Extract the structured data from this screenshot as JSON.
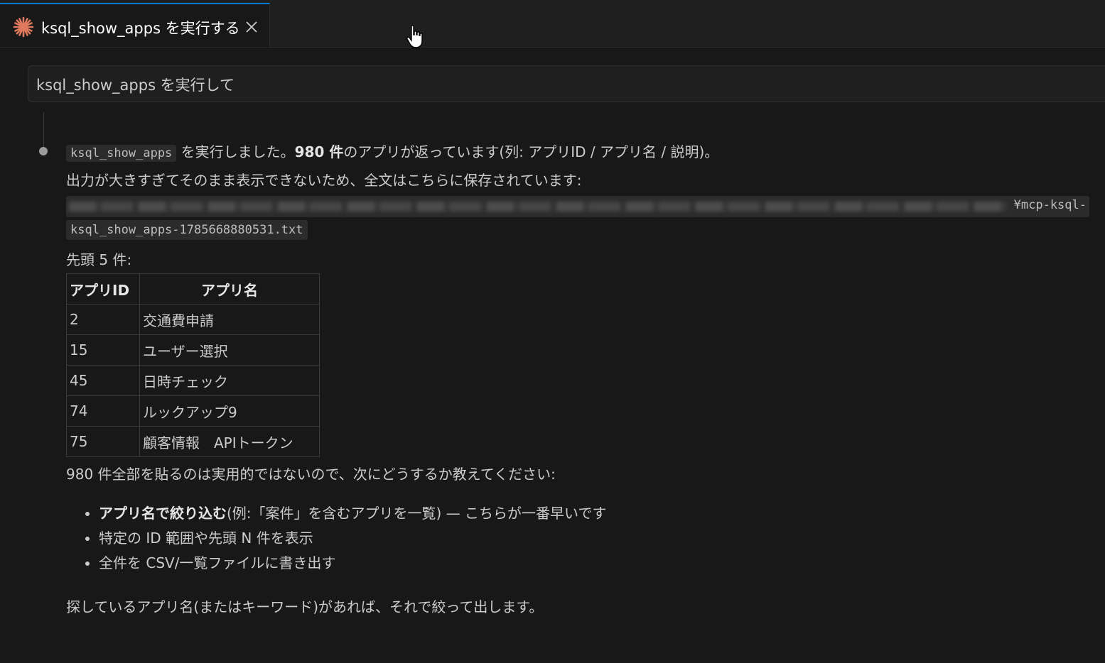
{
  "tab": {
    "title": "ksql_show_apps を実行する",
    "icon": "sparkle-icon",
    "accent": "#e07a5f"
  },
  "prompt": {
    "text": "ksql_show_apps を実行して"
  },
  "response": {
    "code_name": "ksql_show_apps",
    "line1_after_code": " を実行しました。",
    "line1_count": "980 件",
    "line1_rest": "のアプリが返っています(列: アプリID / アプリ名 / 説明)。",
    "line2": "出力が大きすぎてそのまま表示できないため、全文はこちらに保存されています:",
    "path_end": "¥mcp-ksql-",
    "file_name": "ksql_show_apps-1785668880531.txt",
    "preview_label": "先頭 5 件:",
    "table": {
      "headers": [
        "アプリID",
        "アプリ名"
      ],
      "rows": [
        [
          "2",
          "交通費申請"
        ],
        [
          "15",
          "ユーザー選択"
        ],
        [
          "45",
          "日時チェック"
        ],
        [
          "74",
          "ルックアップ9"
        ],
        [
          "75",
          "顧客情報　APIトークン"
        ]
      ]
    },
    "question": "980 件全部を貼るのは実用的ではないので、次にどうするか教えてください:",
    "options": [
      {
        "bold": "アプリ名で絞り込む",
        "text": "(例:「案件」を含むアプリを一覧) — こちらが一番早いです"
      },
      {
        "bold": "",
        "text": "特定の ID 範囲や先頭 N 件を表示"
      },
      {
        "bold": "",
        "text": "全件を CSV/一覧ファイルに書き出す"
      }
    ],
    "closing": "探しているアプリ名(またはキーワード)があれば、それで絞って出します。"
  }
}
